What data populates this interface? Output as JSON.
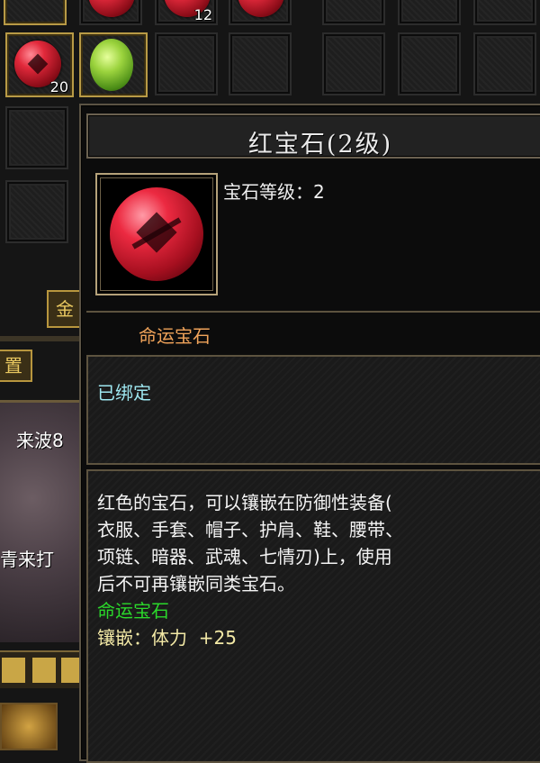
{
  "inventory": {
    "slots": [
      {
        "item": "ruby",
        "quantity": "20"
      },
      {
        "item": "peridot",
        "quantity": ""
      }
    ],
    "top_row_quantity": "12"
  },
  "left_panel": {
    "button_partial": "金",
    "settings_partial": "置",
    "scene_text_1": "来波8",
    "scene_text_2": "青来打"
  },
  "tooltip": {
    "title": "红宝石(2级)",
    "gem_level_label": "宝石等级：",
    "gem_level_value": "2",
    "category": "命运宝石",
    "bind_status": "已绑定",
    "description_lines": [
      "红色的宝石，可以镶嵌在防御性装备(",
      "衣服、手套、帽子、护肩、鞋、腰带、",
      "项链、暗器、武魂、七情刃)上，使用",
      "后不可再镶嵌同类宝石。"
    ],
    "set_name": "命运宝石",
    "inlay_label": "镶嵌：",
    "inlay_stat": "体力",
    "inlay_value": "+25"
  },
  "colors": {
    "category": "#f0a35a",
    "bind_status": "#9ee7f0",
    "set_name": "#2bd82b",
    "inlay": "#f3e9a6",
    "frame_gold": "#b89a46"
  }
}
